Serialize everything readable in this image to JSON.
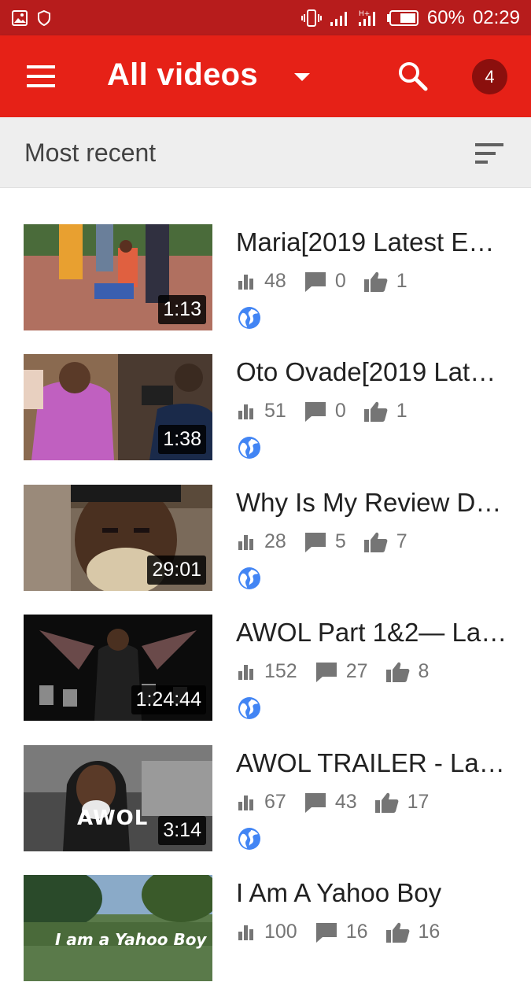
{
  "status_bar": {
    "battery": "60%",
    "time": "02:29",
    "icons": [
      "image-icon",
      "shield-icon",
      "vibrate-icon",
      "signal-icon",
      "signal-h-icon",
      "battery-icon"
    ]
  },
  "app_bar": {
    "title": "All videos",
    "notification_count": "4",
    "icons": [
      "menu-icon",
      "dropdown-arrow-icon",
      "search-icon"
    ]
  },
  "sort": {
    "label": "Most recent",
    "icon": "sort-icon"
  },
  "colors": {
    "status_bar": "#b71c1c",
    "app_bar": "#e62117",
    "badge": "#8b0f0d",
    "public_globe": "#4285f4",
    "sort_bar": "#eeeeee"
  },
  "videos": [
    {
      "title": "Maria[2019 Latest E…",
      "duration": "1:13",
      "views": "48",
      "comments": "0",
      "likes": "1",
      "visibility": "public-globe-icon"
    },
    {
      "title": "Oto Ovade[2019 Late…",
      "duration": "1:38",
      "views": "51",
      "comments": "0",
      "likes": "1",
      "visibility": "public-globe-icon"
    },
    {
      "title": "Why Is My Review D…",
      "duration": "29:01",
      "views": "28",
      "comments": "5",
      "likes": "7",
      "visibility": "public-globe-icon"
    },
    {
      "title": "AWOL Part 1&2— Lat…",
      "duration": "1:24:44",
      "views": "152",
      "comments": "27",
      "likes": "8",
      "visibility": "public-globe-icon"
    },
    {
      "title": "AWOL TRAILER - Lat…",
      "duration": "3:14",
      "views": "67",
      "comments": "43",
      "likes": "17",
      "visibility": "public-globe-icon"
    },
    {
      "title": "I Am A Yahoo Boy",
      "duration": "",
      "views": "100",
      "comments": "16",
      "likes": "16",
      "visibility": "public-globe-icon"
    }
  ],
  "thumbnail_text": {
    "awol": "AWOL",
    "yahoo": "I am a Yahoo Boy"
  }
}
